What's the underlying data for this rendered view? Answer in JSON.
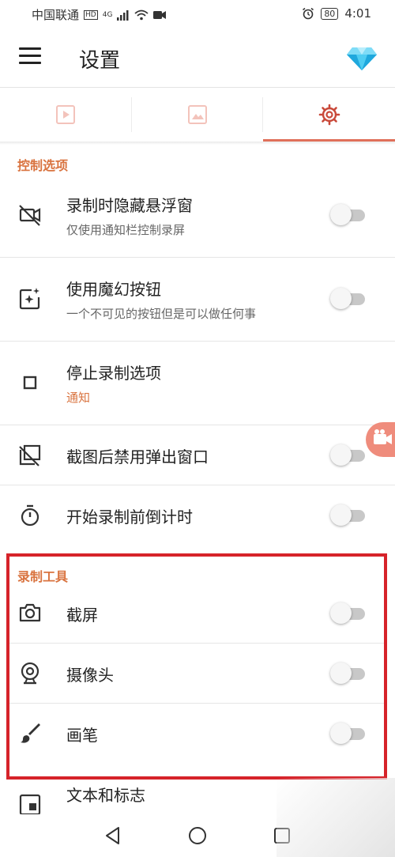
{
  "status_bar": {
    "carrier": "中国联通",
    "network": "4G",
    "battery": "80",
    "time": "4:01"
  },
  "toolbar": {
    "title": "设置"
  },
  "tabs": [
    {
      "name": "video-tab",
      "icon": "play-icon",
      "active": false
    },
    {
      "name": "image-tab",
      "icon": "image-icon",
      "active": false
    },
    {
      "name": "settings-tab",
      "icon": "gear-icon",
      "active": true
    }
  ],
  "control_section": {
    "header": "控制选项",
    "items": [
      {
        "title": "录制时隐藏悬浮窗",
        "subtitle": "仅使用通知栏控制录屏",
        "icon": "video-off-icon",
        "toggle": false
      },
      {
        "title": "使用魔幻按钮",
        "subtitle": "一个不可见的按钮但是可以做任何事",
        "icon": "magic-button-icon",
        "toggle": false
      },
      {
        "title": "停止录制选项",
        "subtitle": "通知",
        "icon": "stop-square-icon"
      },
      {
        "title": "截图后禁用弹出窗口",
        "icon": "screenshot-popup-off-icon",
        "toggle": false
      },
      {
        "title": "开始录制前倒计时",
        "icon": "timer-icon",
        "toggle": false
      }
    ]
  },
  "tools_section": {
    "header": "录制工具",
    "items": [
      {
        "title": "截屏",
        "icon": "camera-icon",
        "toggle": false
      },
      {
        "title": "摄像头",
        "icon": "webcam-icon",
        "toggle": false
      },
      {
        "title": "画笔",
        "icon": "brush-icon",
        "toggle": false
      },
      {
        "title": "文本和标志",
        "icon": "picture-in-picture-icon"
      }
    ]
  },
  "colors": {
    "accent": "#d9733f",
    "tab_active": "#e0705a",
    "highlight_box": "#d6232a",
    "fab": "#ef8c7c"
  }
}
